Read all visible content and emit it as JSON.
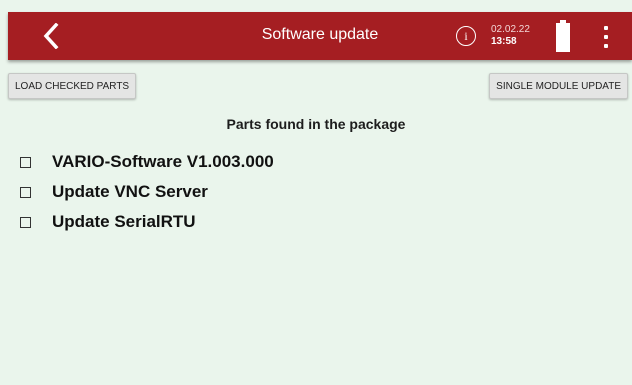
{
  "header": {
    "title": "Software update",
    "date": "02.02.22",
    "time": "13:58",
    "info_glyph": "i",
    "icons": [
      "back-arrow-icon",
      "info-icon",
      "battery-icon",
      "more-vert-icon"
    ],
    "bar_color": "#a51e22"
  },
  "toolbar": {
    "load_label": "LOAD CHECKED PARTS",
    "single_label": "SINGLE MODULE UPDATE"
  },
  "main": {
    "heading": "Parts found in the package",
    "parts": [
      {
        "label": "VARIO-Software V1.003.000",
        "checked": false
      },
      {
        "label": "Update VNC Server",
        "checked": false
      },
      {
        "label": "Update SerialRTU",
        "checked": false
      }
    ]
  },
  "status": {
    "battery_level": 1.0
  }
}
